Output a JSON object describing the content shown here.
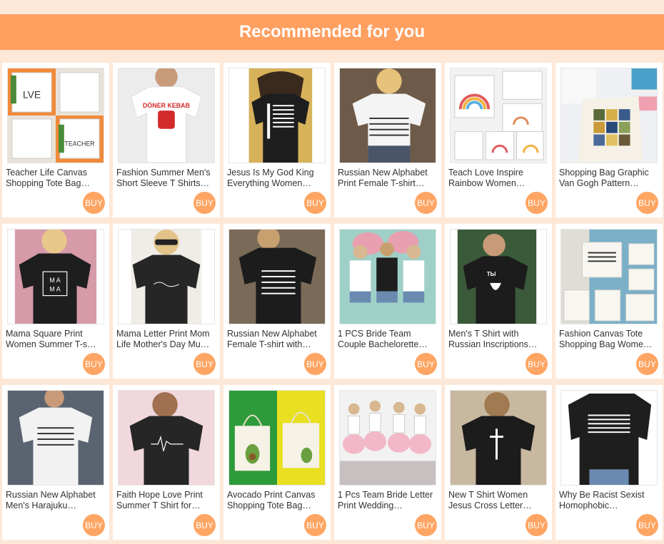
{
  "header": {
    "title": "Recommended for you"
  },
  "colors": {
    "banner": "#ff9f60",
    "buy_button": "#ffa563",
    "page_bg": "#fde8d8"
  },
  "products": [
    {
      "title": "Teacher Life Canvas Shopping Tote Bag…",
      "buy_label": "BUY",
      "image_icon": "tote-bag-teacher-image"
    },
    {
      "title": "Fashion Summer Men's Short Sleeve T Shirts…",
      "buy_label": "BUY",
      "image_icon": "white-tshirt-doner-kebab-image"
    },
    {
      "title": "Jesus Is My God King Everything Women…",
      "buy_label": "BUY",
      "image_icon": "jesus-tshirt-image"
    },
    {
      "title": "Russian New Alphabet Print Female T-shirt…",
      "buy_label": "BUY",
      "image_icon": "russian-alphabet-white-tshirt-image"
    },
    {
      "title": "Teach Love Inspire Rainbow Women…",
      "buy_label": "BUY",
      "image_icon": "rainbow-tote-bags-image"
    },
    {
      "title": "Shopping Bag Graphic Van Gogh Pattern…",
      "buy_label": "BUY",
      "image_icon": "van-gogh-tote-bag-image"
    },
    {
      "title": "Mama Square Print Women Summer T-s…",
      "buy_label": "BUY",
      "image_icon": "mama-tshirt-image"
    },
    {
      "title": "Mama Letter Print Mom Life Mother's Day Mu…",
      "buy_label": "BUY",
      "image_icon": "mama-letter-tshirt-image"
    },
    {
      "title": "Russian New Alphabet Female T-shirt with…",
      "buy_label": "BUY",
      "image_icon": "russian-alphabet-black-tshirt-image"
    },
    {
      "title": "1 PCS Bride Team Couple Bachelorette…",
      "buy_label": "BUY",
      "image_icon": "bride-team-image"
    },
    {
      "title": "Men's T Shirt with Russian Inscriptions…",
      "buy_label": "BUY",
      "image_icon": "russian-inscription-tshirt-image"
    },
    {
      "title": "Fashion Canvas Tote Shopping Bag Wome…",
      "buy_label": "BUY",
      "image_icon": "canvas-tote-bags-image"
    },
    {
      "title": "Russian New Alphabet Men's Harajuku…",
      "buy_label": "BUY",
      "image_icon": "russian-alphabet-mens-tshirt-image"
    },
    {
      "title": "Faith Hope Love Print Summer T Shirt for…",
      "buy_label": "BUY",
      "image_icon": "faith-hope-love-tshirt-image"
    },
    {
      "title": "Avocado Print Canvas Shopping Tote Bag…",
      "buy_label": "BUY",
      "image_icon": "avocado-tote-bag-image"
    },
    {
      "title": "1 Pcs Team Bride Letter Print Wedding…",
      "buy_label": "BUY",
      "image_icon": "team-bride-image"
    },
    {
      "title": "New T Shirt Women Jesus Cross Letter…",
      "buy_label": "BUY",
      "image_icon": "jesus-cross-tshirt-image"
    },
    {
      "title": "Why Be Racist Sexist Homophobic…",
      "buy_label": "BUY",
      "image_icon": "why-be-racist-tshirt-image"
    }
  ]
}
